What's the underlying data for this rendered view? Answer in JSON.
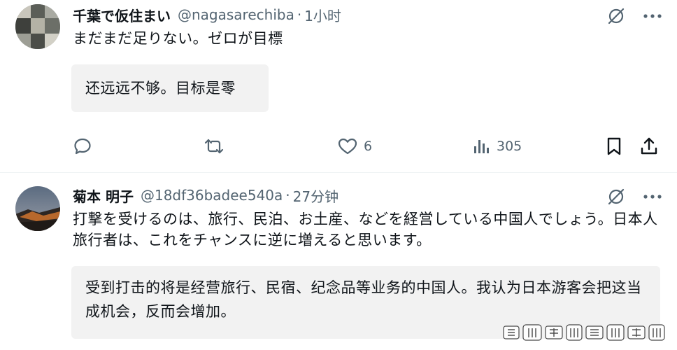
{
  "posts": [
    {
      "name": "千葉で仮住まい",
      "handle": "@nagasarechiba",
      "separator": "·",
      "time": "1小时",
      "text": "まだまだ足りない。ゼロが目標",
      "translation": "还远远不够。目标是零",
      "actions": {
        "reply_count": "",
        "repost_count": "",
        "like_count": "6",
        "view_count": "305"
      }
    },
    {
      "name": "菊本 明子",
      "handle": "@18df36badee540a",
      "separator": "·",
      "time": "27分钟",
      "text": "打撃を受けるのは、旅行、民泊、お土産、などを経営している中国人でしょう。日本人旅行者は、これをチャンスに逆に増えると思います。",
      "translation": "受到打击的将是经营旅行、民宿、纪念品等业务的中国人。我认为日本游客会把这当成机会，反而会增加。"
    }
  ],
  "icons": {
    "post_menu": [
      "grok-icon",
      "more-icon"
    ],
    "actions": [
      "reply-icon",
      "repost-icon",
      "like-icon",
      "views-icon",
      "bookmark-icon",
      "share-icon"
    ]
  },
  "colors": {
    "text": "#0f1419",
    "secondary": "#536471",
    "translation_bg": "#f2f2f2",
    "divider": "#eff3f4"
  }
}
